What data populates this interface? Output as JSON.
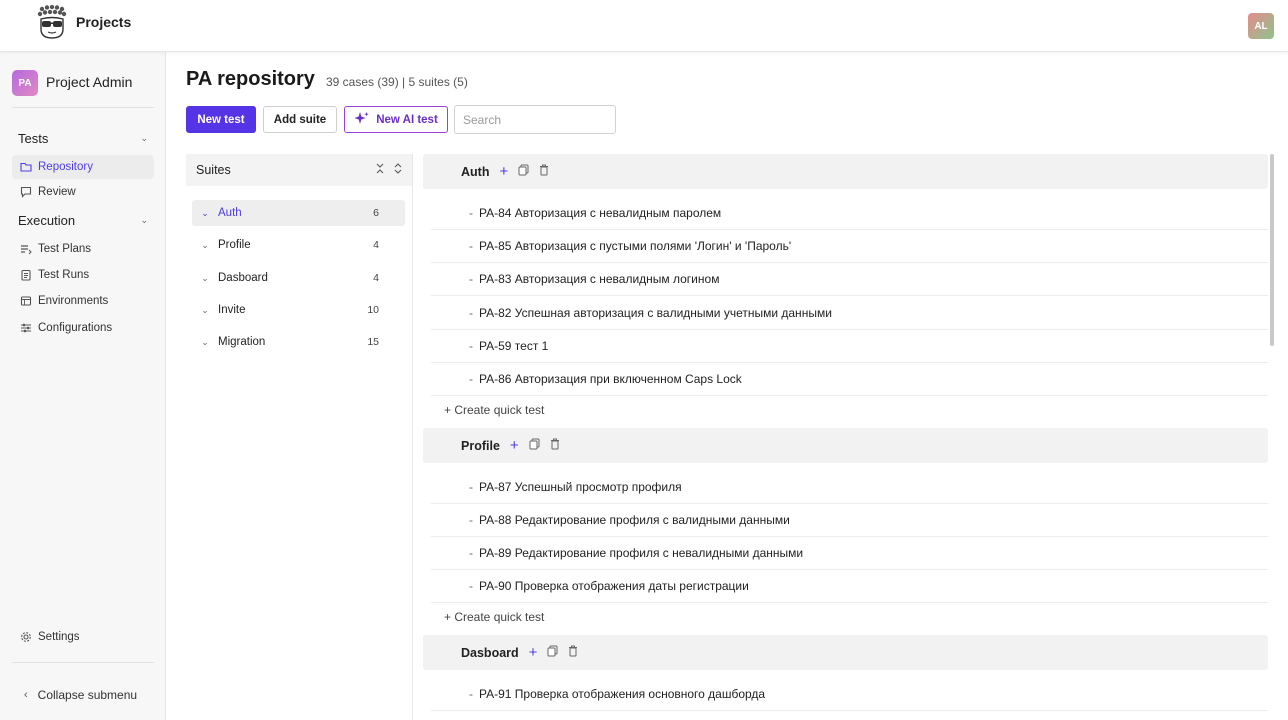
{
  "topbar": {
    "title": "Projects",
    "user_initials": "AL"
  },
  "sidebar": {
    "project_initials": "PA",
    "project_name": "Project Admin",
    "sections": [
      {
        "label": "Tests",
        "items": [
          {
            "label": "Repository",
            "icon": "folder-icon",
            "active": true
          },
          {
            "label": "Review",
            "icon": "review-icon",
            "active": false
          }
        ]
      },
      {
        "label": "Execution",
        "items": [
          {
            "label": "Test Plans",
            "icon": "list-icon"
          },
          {
            "label": "Test Runs",
            "icon": "clipboard-icon"
          },
          {
            "label": "Environments",
            "icon": "environment-icon"
          },
          {
            "label": "Configurations",
            "icon": "sliders-icon"
          }
        ]
      }
    ],
    "settings_label": "Settings",
    "collapse_label": "Collapse submenu"
  },
  "page": {
    "title": "PA repository",
    "meta": "39 cases (39) | 5 suites (5)",
    "new_test_label": "New test",
    "add_suite_label": "Add suite",
    "new_ai_test_label": "New AI test",
    "search_placeholder": "Search"
  },
  "suites_panel": {
    "title": "Suites",
    "suites": [
      {
        "name": "Auth",
        "count": "6",
        "active": true
      },
      {
        "name": "Profile",
        "count": "4"
      },
      {
        "name": "Dasboard",
        "count": "4"
      },
      {
        "name": "Invite",
        "count": "10"
      },
      {
        "name": "Migration",
        "count": "15"
      }
    ]
  },
  "cases": {
    "quick_label": "+ Create quick test",
    "groups": [
      {
        "name": "Auth",
        "items": [
          "PA-84 Авторизация с невалидным паролем",
          "PA-85 Авторизация с пустыми полями 'Логин' и 'Пароль'",
          "PA-83 Авторизация с невалидным логином",
          "PA-82 Успешная авторизация с валидными учетными данными",
          "PA-59 тест 1",
          "PA-86 Авторизация при включенном Caps Lock"
        ]
      },
      {
        "name": "Profile",
        "items": [
          "PA-87 Успешный просмотр профиля",
          "PA-88 Редактирование профиля с валидными данными",
          "PA-89 Редактирование профиля с невалидными данными",
          "PA-90 Проверка отображения даты регистрации"
        ]
      },
      {
        "name": "Dasboard",
        "items": [
          "PA-91 Проверка отображения основного дашборда"
        ]
      }
    ]
  }
}
